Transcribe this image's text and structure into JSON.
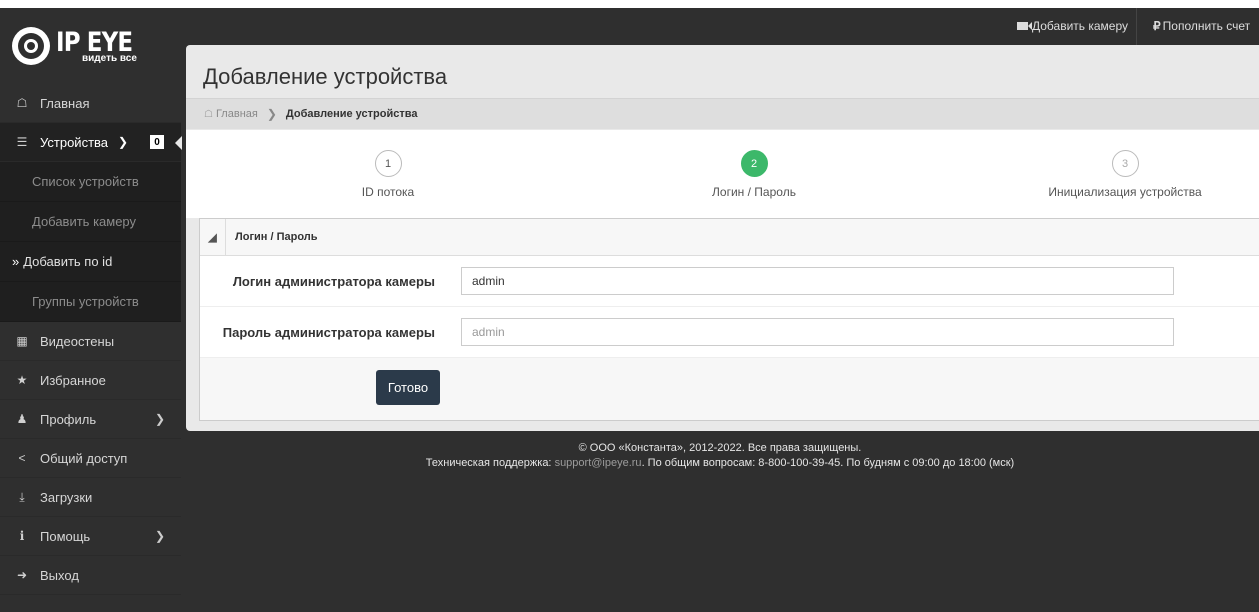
{
  "brand": {
    "title": "IP EYE",
    "tagline": "видеть все"
  },
  "sidebar": {
    "items": [
      {
        "label": "Главная",
        "icon": "home-icon"
      },
      {
        "label": "Устройства",
        "icon": "list-icon",
        "badge": "0"
      },
      {
        "label": "Видеостены",
        "icon": "grid-icon"
      },
      {
        "label": "Избранное",
        "icon": "star-icon"
      },
      {
        "label": "Профиль",
        "icon": "user-icon"
      },
      {
        "label": "Общий доступ",
        "icon": "share-icon"
      },
      {
        "label": "Загрузки",
        "icon": "download-icon"
      },
      {
        "label": "Помощь",
        "icon": "info-icon"
      },
      {
        "label": "Выход",
        "icon": "logout-icon"
      }
    ],
    "sub_items": [
      {
        "label": "Список устройств"
      },
      {
        "label": "Добавить камеру"
      },
      {
        "label": "Добавить по id"
      },
      {
        "label": "Группы устройств"
      }
    ]
  },
  "topbar": {
    "add_camera": "Добавить камеру",
    "top_up": "Пополнить счет"
  },
  "page": {
    "title": "Добавление устройства",
    "breadcrumb": {
      "home": "Главная",
      "current": "Добавление устройства"
    }
  },
  "wizard": {
    "steps": [
      {
        "num": "1",
        "label": "ID потока"
      },
      {
        "num": "2",
        "label": "Логин / Пароль"
      },
      {
        "num": "3",
        "label": "Инициализация устройства"
      }
    ],
    "active_step": 2
  },
  "form": {
    "section_title": "Логин / Пароль",
    "login_label": "Логин администратора камеры",
    "login_value": "admin",
    "password_label": "Пароль администратора камеры",
    "password_placeholder": "admin",
    "submit": "Готово"
  },
  "footer": {
    "copyright": "© ООО «Константа», 2012-2022. Все права защищены.",
    "support_prefix": "Техническая поддержка:",
    "support_email": "support@ipeye.ru",
    "support_suffix": ". По общим вопросам: 8-800-100-39-45. По будням с 09:00 до 18:00 (мск)"
  },
  "colors": {
    "sidebar_bg": "#2f2f2f",
    "panel_bg": "#e9e9e9",
    "active_step": "#3cb86a",
    "button_bg": "#2b3a4a"
  }
}
